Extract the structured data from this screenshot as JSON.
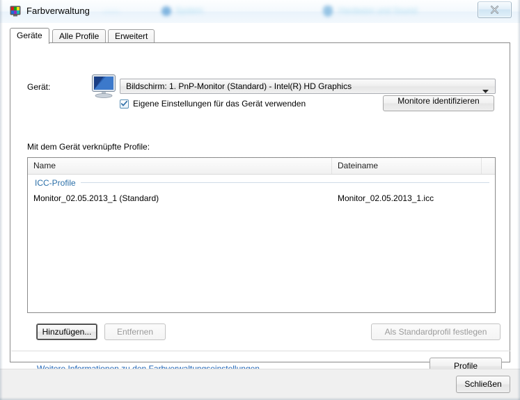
{
  "window": {
    "title": "Farbverwaltung",
    "icon": "color-management-icon",
    "close_button_label": "X",
    "close_button_icon": "close-icon",
    "glass_ghost_labels": [
      "System",
      "Hardware und Sound"
    ]
  },
  "tabs": [
    {
      "label": "Geräte",
      "active": true
    },
    {
      "label": "Alle Profile",
      "active": false
    },
    {
      "label": "Erweitert",
      "active": false
    }
  ],
  "device": {
    "label": "Gerät:",
    "icon": "monitor-icon",
    "combo_value": "Bildschirm: 1. PnP-Monitor (Standard) - Intel(R) HD Graphics",
    "combo_arrow_icon": "chevron-down-icon",
    "checkbox_label": "Eigene Einstellungen für das Gerät verwenden",
    "checkbox_checked": true,
    "identify_button_label": "Monitore identifizieren"
  },
  "profiles": {
    "section_label": "Mit dem Gerät verknüpfte Profile:",
    "columns": [
      "Name",
      "Dateiname",
      ""
    ],
    "group_label": "ICC-Profile",
    "rows": [
      {
        "name": "Monitor_02.05.2013_1 (Standard)",
        "filename": "Monitor_02.05.2013_1.icc"
      }
    ]
  },
  "actions": {
    "add_label": "Hinzufügen...",
    "remove_label": "Entfernen",
    "set_default_label": "Als Standardprofil festlegen",
    "add_enabled": true,
    "remove_enabled": false,
    "set_default_enabled": false
  },
  "footer_area": {
    "info_link": "Weitere Informationen zu den Farbverwaltungseinstellungen",
    "profile_button_label": "Profile",
    "close_button_label": "Schließen"
  },
  "colors": {
    "link": "#1b62b5",
    "group_header": "#2b6fa8",
    "footer_bg": "#f0f0f0",
    "dialog_bg": "#ffffff",
    "border": "#8a8a8a"
  }
}
